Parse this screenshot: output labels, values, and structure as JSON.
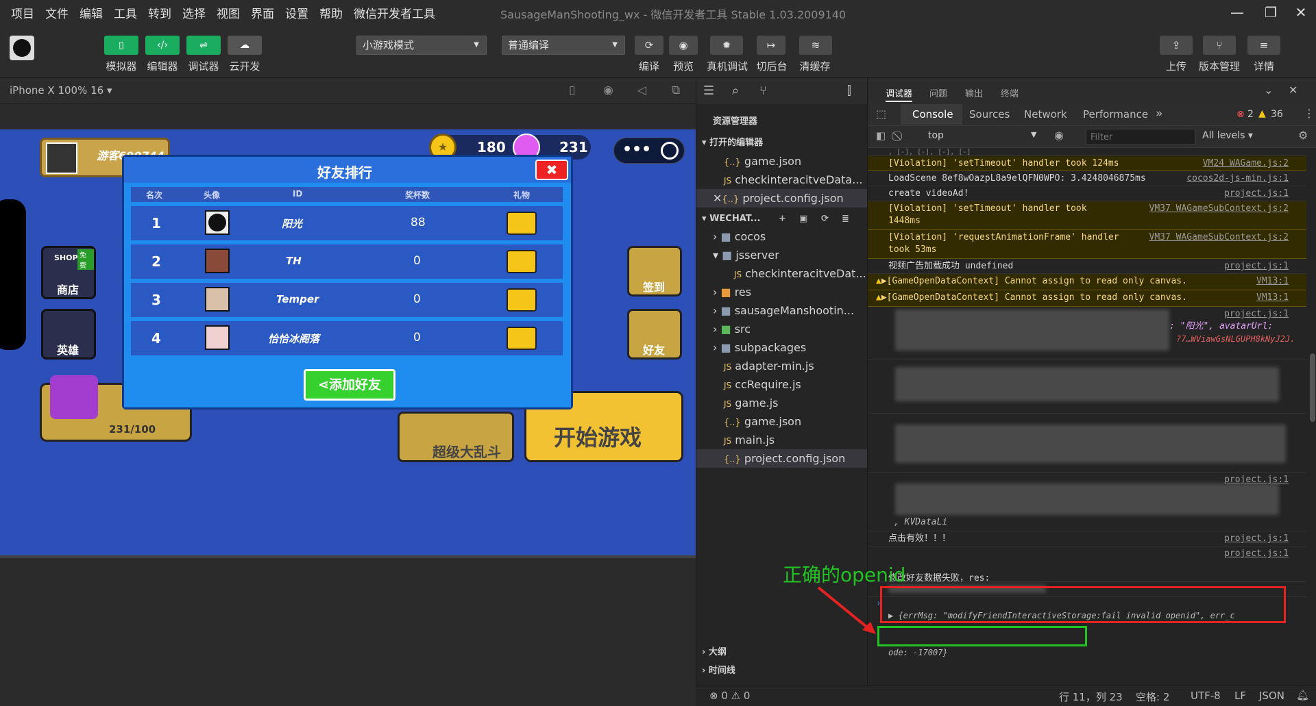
{
  "menu": [
    "项目",
    "文件",
    "编辑",
    "工具",
    "转到",
    "选择",
    "视图",
    "界面",
    "设置",
    "帮助",
    "微信开发者工具"
  ],
  "window_title": "SausageManShooting_wx - 微信开发者工具 Stable 1.03.2009140",
  "toolbar": {
    "left_buttons": [
      "模拟器",
      "编辑器",
      "调试器",
      "云开发"
    ],
    "mode_select": "小游戏模式",
    "compile_select": "普通编译",
    "mid_buttons": [
      "编译",
      "预览",
      "真机调试",
      "切后台",
      "清缓存"
    ],
    "right_buttons": [
      "上传",
      "版本管理",
      "详情"
    ]
  },
  "simulator": {
    "device": "iPhone X 100% 16 ▾"
  },
  "game": {
    "player_name": "游客690744",
    "coins": "180",
    "gems": "231",
    "panel_title": "好友排行",
    "columns": [
      "名次",
      "头像",
      "ID",
      "奖杯数",
      "礼物"
    ],
    "rows": [
      {
        "rank": "1",
        "name": "阳光",
        "score": "88"
      },
      {
        "rank": "2",
        "name": "TH",
        "score": "0"
      },
      {
        "rank": "3",
        "name": "Temper",
        "score": "0"
      },
      {
        "rank": "4",
        "name": "恰恰冰阁落",
        "score": "0"
      }
    ],
    "add_friend": "添加好友",
    "side_left": [
      "商店",
      "英雄"
    ],
    "side_right": [
      "签到",
      "好友"
    ],
    "progress": "231/100",
    "mode_button": "超级大乱斗",
    "start_button": "开始游戏",
    "shop_badge": "SHOP",
    "free_badge": "免费"
  },
  "explorer": {
    "title": "资源管理器",
    "open_editors_header": "打开的编辑器",
    "open_editors": [
      "game.json",
      "checkinteracitveData...",
      "project.config.json"
    ],
    "project_header": "WECHAT...",
    "tree": [
      {
        "name": "cocos",
        "type": "folder"
      },
      {
        "name": "jsserver",
        "type": "folder-open"
      },
      {
        "name": "checkinteracitveDat...",
        "type": "js",
        "indent": true
      },
      {
        "name": "res",
        "type": "folder"
      },
      {
        "name": "sausageManshootin...",
        "type": "folder"
      },
      {
        "name": "src",
        "type": "folder"
      },
      {
        "name": "subpackages",
        "type": "folder"
      },
      {
        "name": "adapter-min.js",
        "type": "js"
      },
      {
        "name": "ccRequire.js",
        "type": "js"
      },
      {
        "name": "game.js",
        "type": "js"
      },
      {
        "name": "game.json",
        "type": "json"
      },
      {
        "name": "main.js",
        "type": "js"
      },
      {
        "name": "project.config.json",
        "type": "json"
      }
    ],
    "outline": "大纲",
    "timeline": "时间线"
  },
  "devtools": {
    "top_tabs": [
      "调试器",
      "问题",
      "输出",
      "终端"
    ],
    "panel_tabs": [
      "Console",
      "Sources",
      "Network",
      "Performance",
      "»"
    ],
    "errors": "2",
    "warnings": "36",
    "context": "top",
    "filter_placeholder": "Filter",
    "levels": "All levels ▾"
  },
  "console_lines": [
    {
      "text": "[Violation] 'setTimeout' handler took 124ms",
      "src": "VM24 WAGame.js:2",
      "warn": true
    },
    {
      "text": "LoadScene 8ef8wOazpL8a9elQFN0WPO: 3.4248046875ms",
      "src": "cocos2d-js-min.js:1",
      "warn": false
    },
    {
      "text": "create videoAd!",
      "src": "project.js:1",
      "warn": false
    },
    {
      "text": "[Violation] 'setTimeout' handler took\n1448ms",
      "src": "VM37 WAGameSubContext.js:2",
      "warn": true
    },
    {
      "text": "[Violation] 'requestAnimationFrame' handler\ntook 53ms",
      "src": "VM37 WAGameSubContext.js:2",
      "warn": true
    },
    {
      "text": "视频广告加载成功 undefined",
      "src": "project.js:1",
      "warn": false
    },
    {
      "text": "▶[GameOpenDataContext] Cannot assign to read only canvas.",
      "src": "VM13:1",
      "warn": true
    },
    {
      "text": "▶[GameOpenDataContext] Cannot assign to read only canvas.",
      "src": "VM13:1",
      "warn": true
    }
  ],
  "console_extra": {
    "src_project": "project.js:1",
    "avatar_fragment": ": \"阳光\", avatarUrl:",
    "url_fragment": "?7…WViawGsNLGUPH8kNyJ2J.",
    "kvdata": ", KVDataLi",
    "click_valid": "点击有效！！！",
    "fail_line1": "修改好友数据失败，res:",
    "fail_line2": "▶ {errMsg: \"modifyFriendInteractiveStorage:fail invalid openid\", err_c",
    "fail_line3": "ode: -17007}",
    "annotation": "正确的openid"
  },
  "statusbar": {
    "problems": "⊗ 0 ⚠ 0",
    "position": "行 11，列 23",
    "spaces": "空格: 2",
    "encoding": "UTF-8",
    "eol": "LF",
    "lang": "JSON"
  },
  "colors": {
    "accent_green": "#1aad5f",
    "game_blue": "#2d4fb8",
    "panel_blue": "#1f8cf0",
    "annotation_green": "#22c322",
    "annotation_red": "#e52222"
  }
}
